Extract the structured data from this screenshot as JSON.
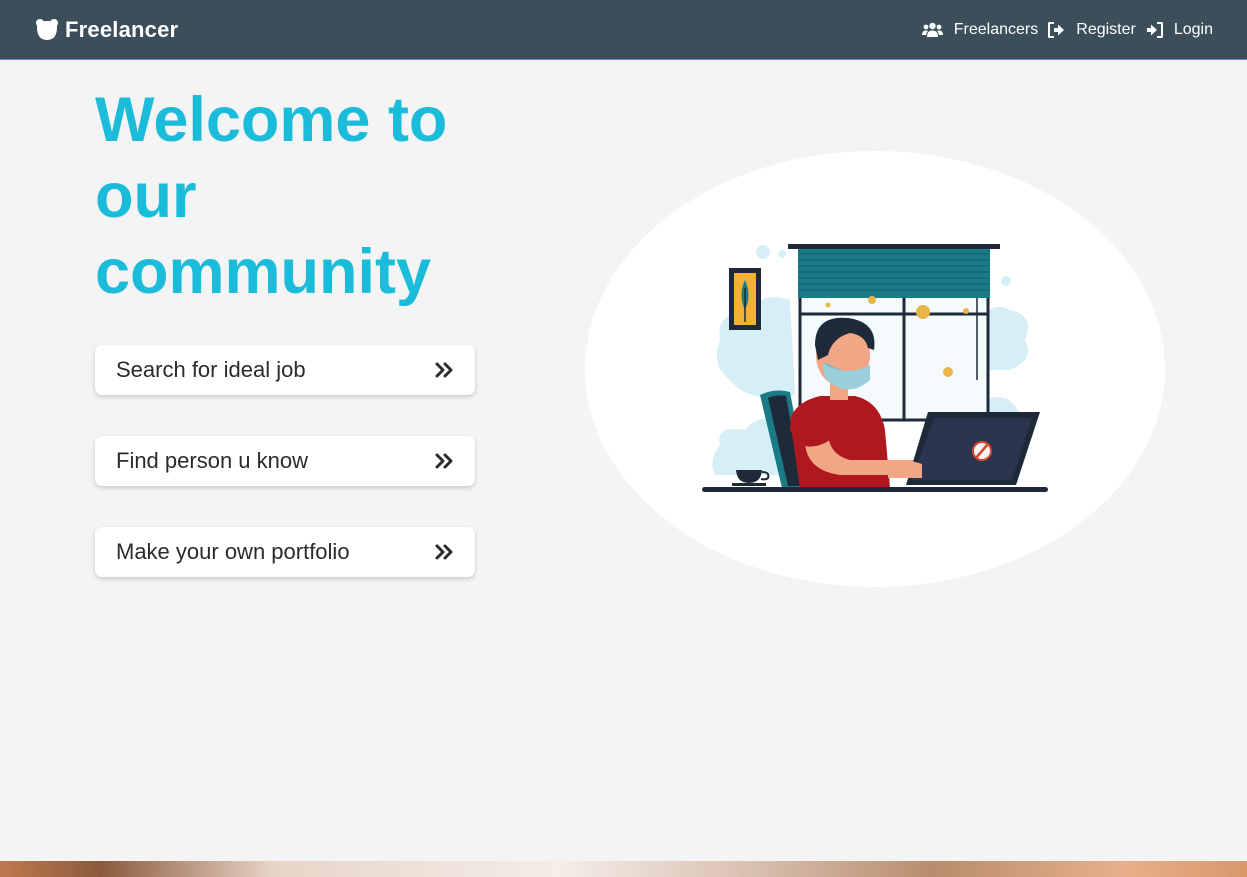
{
  "navbar": {
    "brand": "Freelancer",
    "links": [
      {
        "label": "Freelancers",
        "icon": "users-icon"
      },
      {
        "label": "Register",
        "icon": "sign-out-icon"
      },
      {
        "label": "Login",
        "icon": "sign-in-icon"
      }
    ]
  },
  "hero": {
    "title": "Welcome to our community"
  },
  "actions": [
    {
      "label": "Search for ideal job",
      "icon": "double-chevron-right-icon"
    },
    {
      "label": "Find person u know",
      "icon": "double-chevron-right-icon"
    },
    {
      "label": "Make your own portfolio",
      "icon": "double-chevron-right-icon"
    }
  ],
  "colors": {
    "navbar_bg": "#3c4e5a",
    "accent": "#1bbcda",
    "page_bg": "#f4f4f4"
  }
}
